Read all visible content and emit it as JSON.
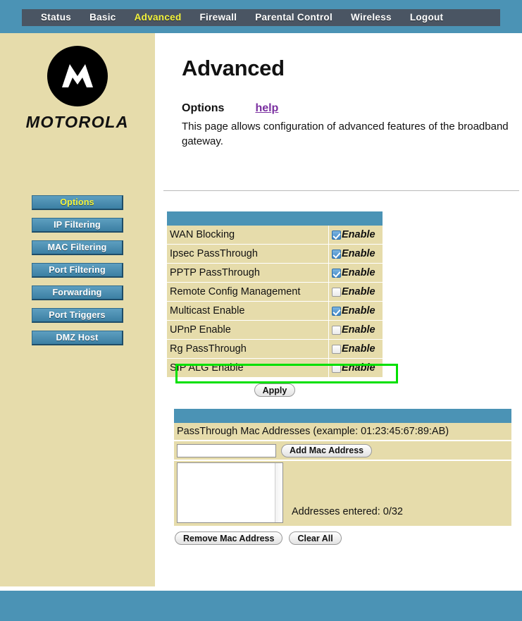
{
  "nav": {
    "items": [
      {
        "label": "Status",
        "active": false
      },
      {
        "label": "Basic",
        "active": false
      },
      {
        "label": "Advanced",
        "active": true
      },
      {
        "label": "Firewall",
        "active": false
      },
      {
        "label": "Parental Control",
        "active": false
      },
      {
        "label": "Wireless",
        "active": false
      },
      {
        "label": "Logout",
        "active": false
      }
    ]
  },
  "sidebar": {
    "brand": "MOTOROLA",
    "items": [
      {
        "label": "Options",
        "active": true
      },
      {
        "label": "IP Filtering",
        "active": false
      },
      {
        "label": "MAC Filtering",
        "active": false
      },
      {
        "label": "Port Filtering",
        "active": false
      },
      {
        "label": "Forwarding",
        "active": false
      },
      {
        "label": "Port Triggers",
        "active": false
      },
      {
        "label": "DMZ Host",
        "active": false
      }
    ]
  },
  "main": {
    "page_title": "Advanced",
    "section_title": "Options",
    "help_label": "help",
    "description": "This page allows configuration of advanced features of the broadband gateway."
  },
  "options_table": {
    "enable_label": "Enable",
    "rows": [
      {
        "label": "WAN Blocking",
        "checked": true,
        "highlighted": false
      },
      {
        "label": "Ipsec PassThrough",
        "checked": true,
        "highlighted": false
      },
      {
        "label": "PPTP PassThrough",
        "checked": true,
        "highlighted": false
      },
      {
        "label": "Remote Config Management",
        "checked": false,
        "highlighted": false
      },
      {
        "label": "Multicast Enable",
        "checked": true,
        "highlighted": false
      },
      {
        "label": "UPnP Enable",
        "checked": false,
        "highlighted": false
      },
      {
        "label": "Rg PassThrough",
        "checked": false,
        "highlighted": false
      },
      {
        "label": "SIP ALG Enable",
        "checked": false,
        "highlighted": true
      }
    ],
    "apply_label": "Apply",
    "highlight_color": "#00e000"
  },
  "mac_section": {
    "title": "PassThrough Mac Addresses (example: 01:23:45:67:89:AB)",
    "input_value": "",
    "input_placeholder": "",
    "add_label": "Add Mac Address",
    "count_label": "Addresses entered: 0/32",
    "list_items": [],
    "remove_label": "Remove Mac Address",
    "clear_label": "Clear All"
  },
  "colors": {
    "band_blue": "#4b93b5",
    "nav_dark": "#4a5563",
    "sidebar_tan": "#e6dcab",
    "accent_yellow": "#f4f43c",
    "link_purple": "#7a2fa0"
  }
}
